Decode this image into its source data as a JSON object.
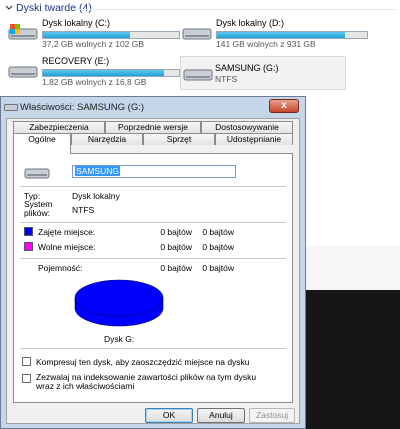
{
  "explorer": {
    "section_title": "Dyski twarde (4)",
    "drives": [
      {
        "name": "Dysk lokalny (C:)",
        "info": "37,2 GB wolnych z 102 GB",
        "used_fraction": 0.64
      },
      {
        "name": "Dysk lokalny (D:)",
        "info": "141 GB wolnych z 931 GB",
        "used_fraction": 0.85
      },
      {
        "name": "RECOVERY (E:)",
        "info": "1,82 GB wolnych z 16,8 GB",
        "used_fraction": 0.89
      },
      {
        "name": "SAMSUNG (G:)",
        "info": "NTFS"
      }
    ]
  },
  "dialog": {
    "title": "Właściwości: SAMSUNG (G:)",
    "close_label": "x",
    "tabs_back": [
      "Zabezpieczenia",
      "Poprzednie wersje",
      "Dostosowywanie"
    ],
    "tabs_front": [
      "Ogólne",
      "Narzędzia",
      "Sprzęt",
      "Udostępnianie"
    ],
    "volume_name": "SAMSUNG",
    "type_label": "Typ:",
    "type_value": "Dysk lokalny",
    "fs_label": "System plików:",
    "fs_label_line1": "System",
    "fs_label_line2": "plików:",
    "fs_value": "NTFS",
    "used_label": "Zajęte miejsce:",
    "used_bytes": "0 bajtów",
    "used_size": "0 bajtów",
    "free_label": "Wolne miejsce:",
    "free_bytes": "0 bajtów",
    "free_size": "0 bajtów",
    "capacity_label": "Pojemność:",
    "capacity_bytes": "0 bajtów",
    "capacity_size": "0 bajtów",
    "disk_caption": "Dysk G:",
    "compress_label": "Kompresuj ten dysk, aby zaoszczędzić miejsce na dysku",
    "index_label_line1": "Zezwalaj na indeksowanie zawartości plików na tym dysku",
    "index_label_line2": "wraz z ich właściwościami",
    "ok_label": "OK",
    "cancel_label": "Anuluj",
    "apply_label": "Zastosuj",
    "colors": {
      "used": "#0000ff",
      "free": "#ff00ff",
      "pie": "#0000ff"
    }
  }
}
